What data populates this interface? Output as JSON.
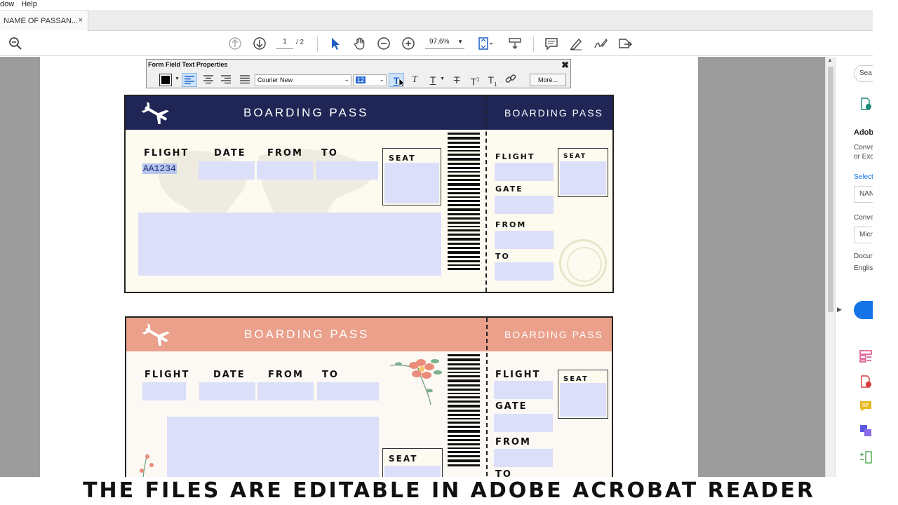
{
  "menubar": {
    "items": [
      "dow",
      "Help"
    ]
  },
  "tab": {
    "title": "NAME OF PASSAN...",
    "close": "×"
  },
  "toolbar": {
    "page_current": "1",
    "page_total": "/ 2",
    "zoom": "97,6%"
  },
  "ffp": {
    "title": "Form Field Text Properties",
    "font": "Courier New",
    "size": "12",
    "more": "More..."
  },
  "right_pane": {
    "search_placeholder": "Sea",
    "heading": "Adob",
    "desc1": "Conve",
    "desc2": "or Exc",
    "select_label": "Select",
    "field1": "NAN",
    "convert_label": "Conve",
    "field2": "Micr",
    "doc_label": "Docur",
    "doc_value": "Englis"
  },
  "pass1": {
    "title": "BOARDING PASS",
    "stub_title": "BOARDING PASS",
    "flight_label": "FLIGHT",
    "date_label": "DATE",
    "from_label": "FROM",
    "to_label": "TO",
    "seat_label": "SEAT",
    "flight_value": "AA1234",
    "stub_flight": "FLIGHT",
    "stub_gate": "GATE",
    "stub_from": "FROM",
    "stub_to": "TO",
    "stub_seat": "SEAT"
  },
  "pass2": {
    "title": "BOARDING PASS",
    "stub_title": "BOARDING PASS",
    "flight_label": "FLIGHT",
    "date_label": "DATE",
    "from_label": "FROM",
    "to_label": "TO",
    "seat_label": "SEAT",
    "stub_flight": "FLIGHT",
    "stub_gate": "GATE",
    "stub_from": "FROM",
    "stub_to": "TO",
    "stub_seat": "SEAT"
  },
  "colors": {
    "pass1_header": "#1f2655",
    "pass2_header": "#eba08c",
    "field_fill": "#dcdffa",
    "accent_blue": "#1473e6"
  },
  "caption": "THE FILES ARE EDITABLE IN ADOBE ACROBAT READER"
}
